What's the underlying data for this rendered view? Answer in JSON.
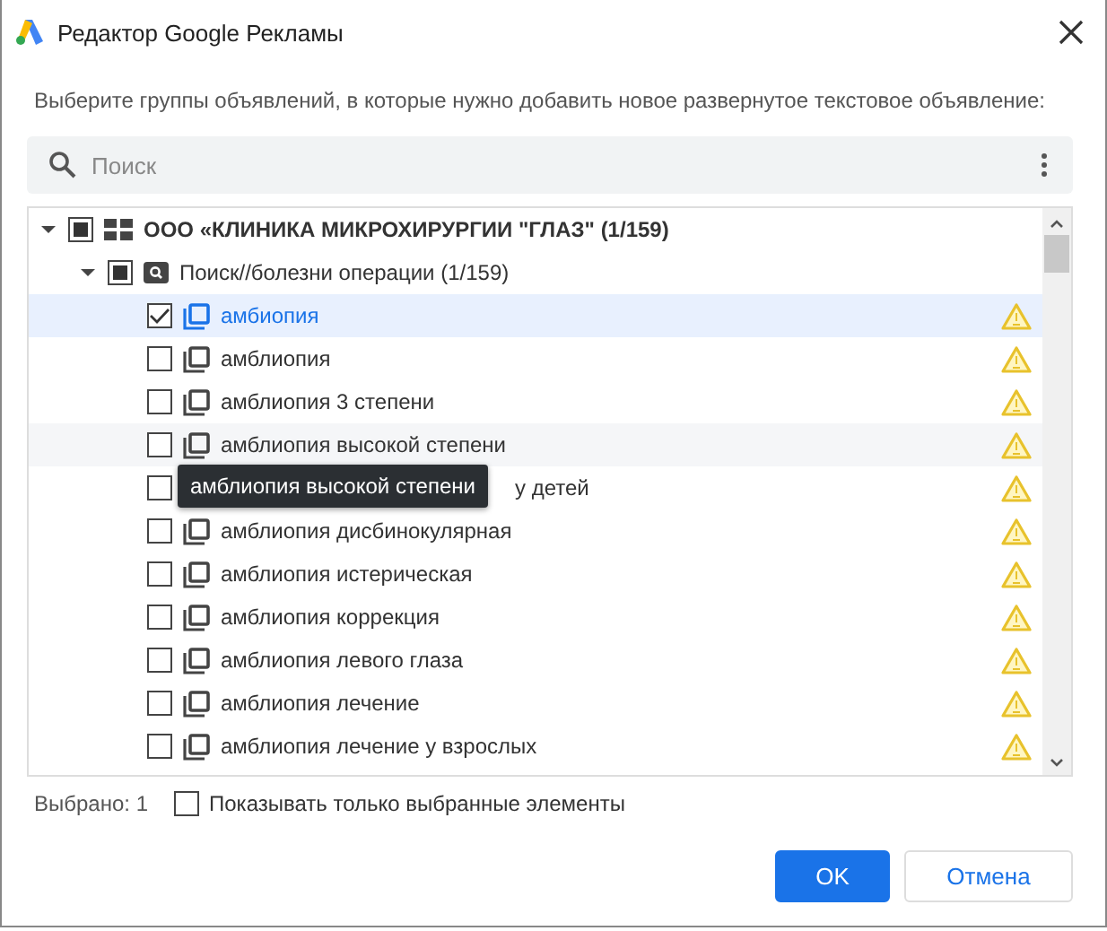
{
  "window": {
    "title": "Редактор Google Рекламы"
  },
  "instruction": "Выберите группы объявлений, в которые нужно добавить новое развернутое текстовое объявление:",
  "search": {
    "placeholder": "Поиск"
  },
  "tree": [
    {
      "label": "ООО «КЛИНИКА МИКРОХИРУРГИИ \"ГЛАЗ\" (1/159)",
      "kind": "account",
      "checked": false,
      "mixed": true,
      "expanded": true,
      "children": [
        {
          "label": "Поиск//болезни операции (1/159)",
          "kind": "campaign",
          "checked": false,
          "mixed": true,
          "expanded": true,
          "children": [
            {
              "label": "амбиопия",
              "kind": "adgroup",
              "checked": true,
              "selected": true,
              "warning": true
            },
            {
              "label": "амблиопия",
              "kind": "adgroup",
              "checked": false,
              "selected": false,
              "warning": true
            },
            {
              "label": "амблиопия 3 степени",
              "kind": "adgroup",
              "checked": false,
              "selected": false,
              "warning": true
            },
            {
              "label": "амблиопия высокой степени",
              "kind": "adgroup",
              "checked": false,
              "selected": false,
              "tooltip": "амблиопия высокой степени",
              "warning": true
            },
            {
              "label": "у детей",
              "kind": "adgroup",
              "checked": false,
              "selected": false,
              "covered": true,
              "warning": true
            },
            {
              "label": "амблиопия дисбинокулярная",
              "kind": "adgroup",
              "checked": false,
              "selected": false,
              "warning": true
            },
            {
              "label": "амблиопия истерическая",
              "kind": "adgroup",
              "checked": false,
              "selected": false,
              "warning": true
            },
            {
              "label": "амблиопия коррекция",
              "kind": "adgroup",
              "checked": false,
              "selected": false,
              "warning": true
            },
            {
              "label": "амблиопия левого глаза",
              "kind": "adgroup",
              "checked": false,
              "selected": false,
              "warning": true
            },
            {
              "label": "амблиопия лечение",
              "kind": "adgroup",
              "checked": false,
              "selected": false,
              "warning": true
            },
            {
              "label": "амблиопия лечение у взрослых",
              "kind": "adgroup",
              "checked": false,
              "selected": false,
              "warning": true
            }
          ]
        }
      ]
    }
  ],
  "footer": {
    "count": "Выбрано: 1",
    "filter": {
      "label": "Показывать только выбранные элементы",
      "checked": false
    }
  },
  "buttons": [
    {
      "label": "OK",
      "kind": "primary"
    },
    {
      "label": "Отмена",
      "kind": "secondary"
    }
  ]
}
